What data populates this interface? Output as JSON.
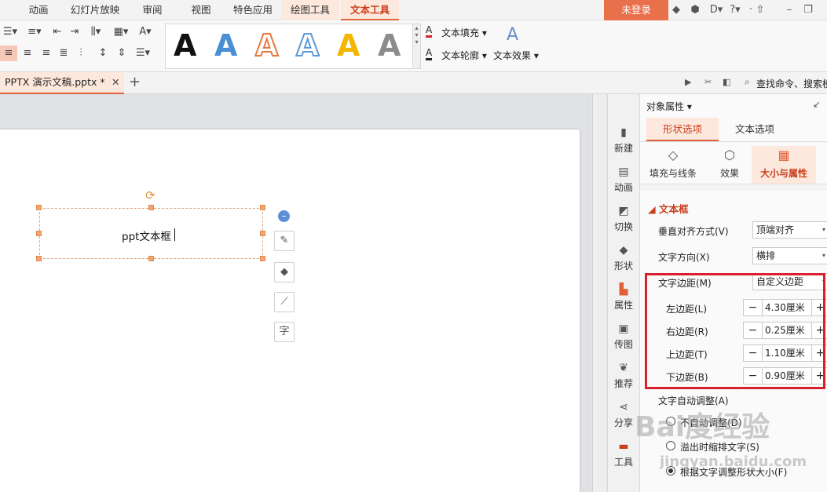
{
  "menubar": {
    "tabs": [
      "动画",
      "幻灯片放映",
      "审阅",
      "视图",
      "特色应用",
      "绘图工具",
      "文本工具"
    ],
    "login": "未登录"
  },
  "ribbon": {
    "text_fill": "文本填充",
    "text_outline": "文本轮廓",
    "text_effect": "文本效果",
    "art_glyph": "A",
    "art_colors": [
      "#111111",
      "#4a8fd4",
      "#e8783e",
      "#5b9bd5",
      "#f2b600",
      "#8c8c8c"
    ]
  },
  "tabbar": {
    "doc_tab": "PPTX 演示文稿.pptx *",
    "search": "查找命令、搜索模"
  },
  "slide": {
    "textbox_text": "ppt文本框"
  },
  "sidetools": [
    "新建",
    "动画",
    "切换",
    "形状",
    "属性",
    "传图",
    "推荐",
    "分享",
    "工具"
  ],
  "panel": {
    "title": "对象属性",
    "tabs": [
      "形状选项",
      "文本选项"
    ],
    "subtabs": [
      "填充与线条",
      "效果",
      "大小与属性"
    ],
    "section": "文本框",
    "vertical_align_label": "垂直对齐方式(V)",
    "vertical_align_value": "顶端对齐",
    "text_direction_label": "文字方向(X)",
    "text_direction_value": "横排",
    "margin_label": "文字边距(M)",
    "margin_value": "自定义边距",
    "margins": [
      {
        "label": "左边距(L)",
        "value": "4.30厘米"
      },
      {
        "label": "右边距(R)",
        "value": "0.25厘米"
      },
      {
        "label": "上边距(T)",
        "value": "1.10厘米"
      },
      {
        "label": "下边距(B)",
        "value": "0.90厘米"
      }
    ],
    "autofit_label": "文字自动调整(A)",
    "autofit_options": [
      "不自动调整(D)",
      "溢出时缩排文字(S)",
      "根据文字调整形状大小(F)"
    ],
    "autofit_selected": 2
  },
  "watermark": {
    "brand": "Bai度经验",
    "url": "jingyan.baidu.com"
  },
  "colors": {
    "accent": "#e0613a",
    "highlight": "#d9202c"
  }
}
